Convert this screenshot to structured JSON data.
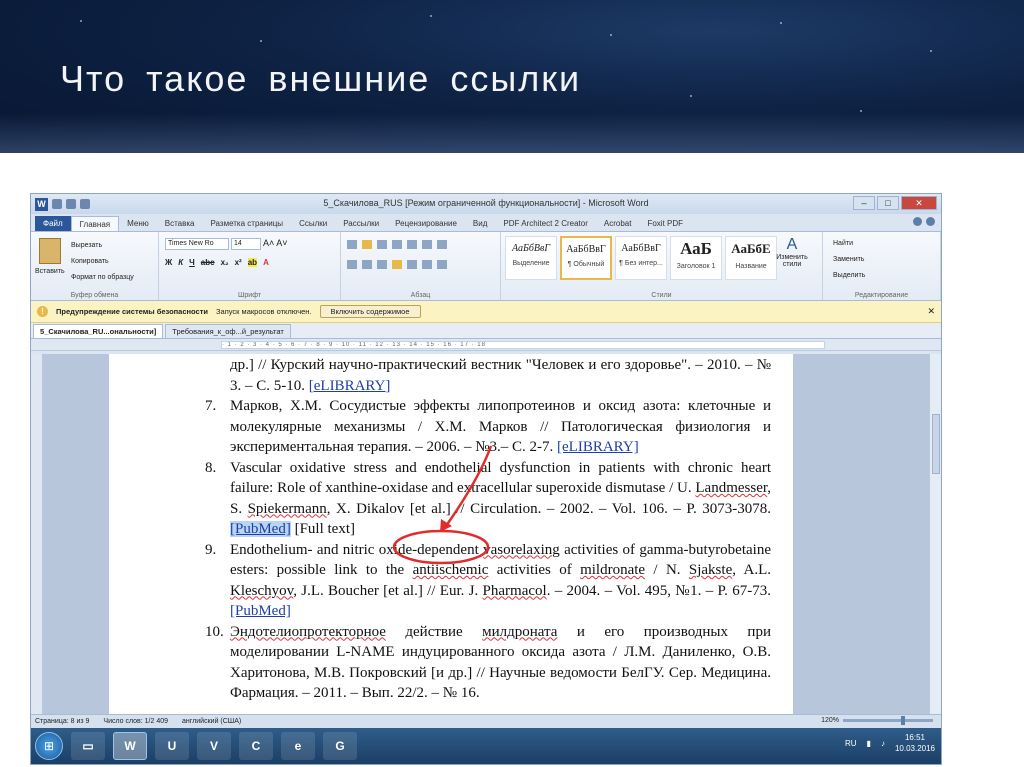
{
  "slide": {
    "title": "Что такое внешние ссылки"
  },
  "window": {
    "title": "5_Скачилова_RUS [Режим ограниченной функциональности] - Microsoft Word",
    "tabs": [
      "Файл",
      "Главная",
      "Меню",
      "Вставка",
      "Разметка страницы",
      "Ссылки",
      "Рассылки",
      "Рецензирование",
      "Вид",
      "PDF Architect 2 Creator",
      "Acrobat",
      "Foxit PDF"
    ],
    "active_tab": "Главная"
  },
  "ribbon": {
    "clipboard": {
      "paste": "Вставить",
      "cut": "Вырезать",
      "copy": "Копировать",
      "format_painter": "Формат по образцу",
      "label": "Буфер обмена"
    },
    "font": {
      "name": "Times New Ro",
      "size": "14",
      "label": "Шрифт"
    },
    "paragraph": {
      "label": "Абзац"
    },
    "styles": {
      "label": "Стили",
      "cards": [
        {
          "sample": "АаБбВвГ",
          "name": "Выделение"
        },
        {
          "sample": "АаБбВвГ",
          "name": "¶ Обычный"
        },
        {
          "sample": "АаБбВвГ",
          "name": "¶ Без интер..."
        },
        {
          "sample": "АаБ",
          "name": "Заголовок 1"
        },
        {
          "sample": "АаБбЕ",
          "name": "Название"
        }
      ],
      "change_styles": "Изменить стили"
    },
    "editing": {
      "find": "Найти",
      "replace": "Заменить",
      "select": "Выделить",
      "label": "Редактирование"
    }
  },
  "security_bar": {
    "title": "Предупреждение системы безопасности",
    "message": "Запуск макросов отключен.",
    "button": "Включить содержимое"
  },
  "doc_tabs": [
    "5_Скачилова_RU...ональности]",
    "Требования_к_оф...й_результат"
  ],
  "document": {
    "refs": [
      {
        "num": "",
        "segments": [
          {
            "t": "др.] // Курский научно-практический вестник \"Человек и его здоровье\". – 2010. – № 3. – С. 5-10. "
          },
          {
            "t": "[eLIBRARY]",
            "c": "link"
          }
        ]
      },
      {
        "num": "7.",
        "segments": [
          {
            "t": "Марков, Х.М. Сосудистые эффекты липопротеинов и оксид азота: клеточные и молекулярные механизмы / Х.М. Марков // Патологическая физиология и экспериментальная терапия. – 2006. – №3.– С. 2-7. "
          },
          {
            "t": "[eLIBRARY]",
            "c": "link"
          }
        ]
      },
      {
        "num": "8.",
        "segments": [
          {
            "t": "Vascular oxidative stress and endothelial dysfunction in patients with chronic heart failure: Role of xanthine-oxidase and extracellular superoxide dismutase / U. "
          },
          {
            "t": "Landmesser",
            "c": "sq"
          },
          {
            "t": ", S. "
          },
          {
            "t": "Spiekermann",
            "c": "sq"
          },
          {
            "t": ", X. Dikalov [et al.] // Circulation. – 2002. – Vol. 106. – P. 3073-3078. "
          },
          {
            "t": "[PubMed]",
            "c": "link highlight"
          },
          {
            "t": " [Full text]"
          }
        ]
      },
      {
        "num": "9.",
        "segments": [
          {
            "t": "Endothelium- and nitric oxide-dependent "
          },
          {
            "t": "vasorelaxing",
            "c": "sq"
          },
          {
            "t": " activities of gamma-butyrobetaine esters: possible link to the "
          },
          {
            "t": "antiischemic",
            "c": "sq"
          },
          {
            "t": " activities of "
          },
          {
            "t": "mildronate",
            "c": "sq"
          },
          {
            "t": " / N. "
          },
          {
            "t": "Sjakste",
            "c": "sq"
          },
          {
            "t": ", A.L. "
          },
          {
            "t": "Kleschyov",
            "c": "sq"
          },
          {
            "t": ", J.L. Boucher [et al.] // Eur. J. "
          },
          {
            "t": "Pharmacol",
            "c": "sq"
          },
          {
            "t": ". – 2004. – Vol. 495, №1. – P. 67-73. "
          },
          {
            "t": "[PubMed]",
            "c": "link"
          }
        ]
      },
      {
        "num": "10.",
        "segments": [
          {
            "t": "Эндотелиопротекторное",
            "c": "sq"
          },
          {
            "t": " действие "
          },
          {
            "t": "милдроната",
            "c": "sq"
          },
          {
            "t": " и его производных при моделировании L-NAME индуцированного оксида азота / Л.М. Даниленко, О.В. Харитонова, М.В. Покровский [и др.] // Научные ведомости БелГУ. Сер. Медицина. Фармация. – 2011. – Вып. 22/2. – № 16."
          }
        ]
      }
    ]
  },
  "status": {
    "page": "Страница: 8 из 9",
    "words": "Число слов: 1/2 409",
    "lang": "английский (США)",
    "zoom": "120%"
  },
  "taskbar": {
    "apps": [
      "W",
      "U",
      "V",
      "C",
      "e",
      "G"
    ],
    "lang": "RU",
    "time": "16:51",
    "date": "10.03.2016"
  }
}
